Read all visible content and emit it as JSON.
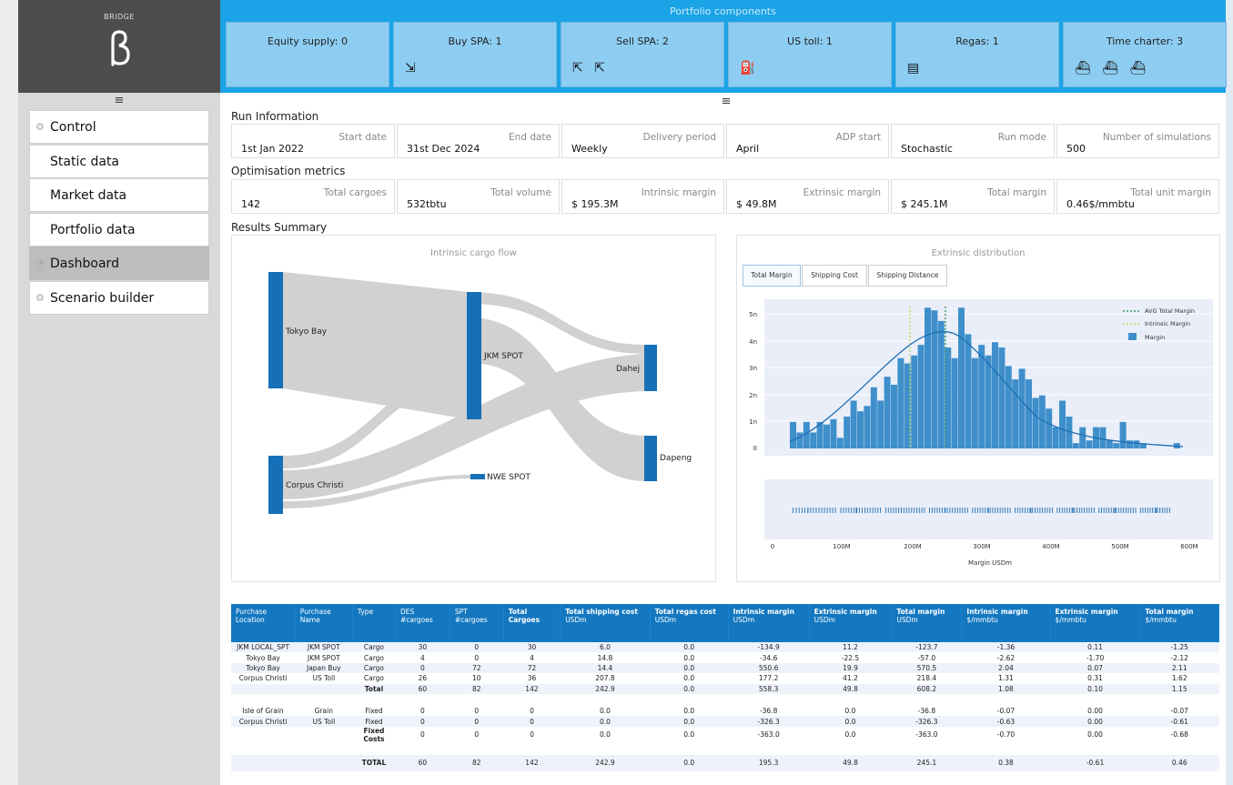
{
  "brand": {
    "name": "BRIDGE"
  },
  "banner": {
    "title": "Portfolio components",
    "cards": [
      {
        "label": "Equity supply: 0",
        "icons": ""
      },
      {
        "label": "Buy SPA: 1",
        "icons": "⇲"
      },
      {
        "label": "Sell SPA: 2",
        "icons": "⇱ ⇱"
      },
      {
        "label": "US toll: 1",
        "icons": "⛽"
      },
      {
        "label": "Regas: 1",
        "icons": "▤"
      },
      {
        "label": "Time charter: 3",
        "icons": "⛴ ⛴ ⛴"
      }
    ]
  },
  "sidebar": {
    "menu_icon": "≡",
    "items": [
      {
        "label": "Control",
        "icon": "⚙"
      },
      {
        "label": "Static data",
        "icon": ""
      },
      {
        "label": "Market data",
        "icon": ""
      },
      {
        "label": "Portfolio data",
        "icon": ""
      },
      {
        "label": "Dashboard",
        "icon": "◔"
      },
      {
        "label": "Scenario builder",
        "icon": "⚙"
      }
    ]
  },
  "main": {
    "menu_icon": "≡",
    "run_info": {
      "title": "Run Information",
      "metrics": [
        {
          "label": "Start date",
          "value": "1st Jan 2022"
        },
        {
          "label": "End date",
          "value": "31st Dec 2024"
        },
        {
          "label": "Delivery period",
          "value": "Weekly"
        },
        {
          "label": "ADP start",
          "value": "April"
        },
        {
          "label": "Run mode",
          "value": "Stochastic"
        },
        {
          "label": "Number of simulations",
          "value": "500"
        }
      ]
    },
    "opt_metrics": {
      "title": "Optimisation metrics",
      "metrics": [
        {
          "label": "Total cargoes",
          "value": "142"
        },
        {
          "label": "Total volume",
          "value": "532tbtu"
        },
        {
          "label": "Intrinsic margin",
          "value": "$ 195.3M"
        },
        {
          "label": "Extrinsic margin",
          "value": "$ 49.8M"
        },
        {
          "label": "Total margin",
          "value": "$ 245.1M"
        },
        {
          "label": "Total unit margin",
          "value": "0.46$/mmbtu"
        }
      ]
    },
    "results_title": "Results Summary",
    "sankey": {
      "title": "Intrinsic cargo flow",
      "nodes": [
        "Tokyo Bay",
        "Corpus Christi",
        "JKM SPOT",
        "NWE SPOT",
        "Dahej",
        "Dapeng"
      ]
    },
    "extrinsic": {
      "title": "Extrinsic distribution",
      "tabs": [
        "Total Margin",
        "Shipping Cost",
        "Shipping Distance"
      ],
      "legend": [
        "AVG Total Margin",
        "Intrinsic Margin",
        "Margin"
      ],
      "yticks": [
        "5n",
        "4n",
        "3n",
        "2n",
        "1n",
        "0"
      ],
      "xticks": [
        "0",
        "100M",
        "200M",
        "300M",
        "400M",
        "500M",
        "600M"
      ],
      "xlabel": "Margin USDm"
    }
  },
  "table": {
    "headers": [
      {
        "bold": "",
        "plain": "Purchase Location"
      },
      {
        "bold": "",
        "plain": "Purchase Name"
      },
      {
        "bold": "",
        "plain": "Type"
      },
      {
        "bold": "",
        "plain": "DES #cargoes"
      },
      {
        "bold": "",
        "plain": "SPT #cargoes"
      },
      {
        "bold": "Total Cargoes",
        "plain": ""
      },
      {
        "bold": "Total shipping cost",
        "plain": "USDm"
      },
      {
        "bold": "Total regas cost",
        "plain": "USDm"
      },
      {
        "bold": "Intrinsic margin",
        "plain": "USDm"
      },
      {
        "bold": "Extrinsic margin",
        "plain": "USDm"
      },
      {
        "bold": "Total margin",
        "plain": "USDm"
      },
      {
        "bold": "Intrinsic margin",
        "plain": "$/mmbtu"
      },
      {
        "bold": "Extrinsic margin",
        "plain": "$/mmbtu"
      },
      {
        "bold": "Total margin",
        "plain": "$/mmbtu"
      }
    ],
    "rows": [
      [
        "JKM LOCAL_SPT",
        "JKM SPOT",
        "Cargo",
        "30",
        "0",
        "30",
        "6.0",
        "0.0",
        "-134.9",
        "11.2",
        "-123.7",
        "-1.36",
        "0.11",
        "-1.25"
      ],
      [
        "Tokyo Bay",
        "JKM SPOT",
        "Cargo",
        "4",
        "0",
        "4",
        "14.8",
        "0.0",
        "-34.6",
        "-22.5",
        "-57.0",
        "-2.62",
        "-1.70",
        "-2.12"
      ],
      [
        "Tokyo Bay",
        "Japan Buy",
        "Cargo",
        "0",
        "72",
        "72",
        "14.4",
        "0.0",
        "550.6",
        "19.9",
        "570.5",
        "2.04",
        "0.07",
        "2.11"
      ],
      [
        "Corpus Christi",
        "US Toll",
        "Cargo",
        "26",
        "10",
        "36",
        "207.8",
        "0.0",
        "177.2",
        "41.2",
        "218.4",
        "1.31",
        "0.31",
        "1.62"
      ],
      [
        "",
        "",
        "Total",
        "60",
        "82",
        "142",
        "242.9",
        "0.0",
        "558.3",
        "49.8",
        "608.2",
        "1.08",
        "0.10",
        "1.15"
      ],
      [
        "Isle of Grain",
        "Grain",
        "Fixed",
        "0",
        "0",
        "0",
        "0.0",
        "0.0",
        "-36.8",
        "0.0",
        "-36.8",
        "-0.07",
        "0.00",
        "-0.07"
      ],
      [
        "Corpus Christi",
        "US Toll",
        "Fixed",
        "0",
        "0",
        "0",
        "0.0",
        "0.0",
        "-326.3",
        "0.0",
        "-326.3",
        "-0.63",
        "0.00",
        "-0.61"
      ],
      [
        "",
        "",
        "Fixed Costs",
        "0",
        "0",
        "0",
        "0.0",
        "0.0",
        "-363.0",
        "0.0",
        "-363.0",
        "-0.70",
        "0.00",
        "-0.68"
      ],
      [
        "",
        "",
        "TOTAL",
        "60",
        "82",
        "142",
        "242.9",
        "0.0",
        "195.3",
        "49.8",
        "245.1",
        "0.38",
        "-0.61",
        "0.46"
      ]
    ]
  },
  "colors": {
    "banner": "#1aa3e6",
    "card": "#8ecdf2",
    "bar": "#3f8fcb",
    "node": "#1670b8",
    "table_header": "#1478c0"
  }
}
